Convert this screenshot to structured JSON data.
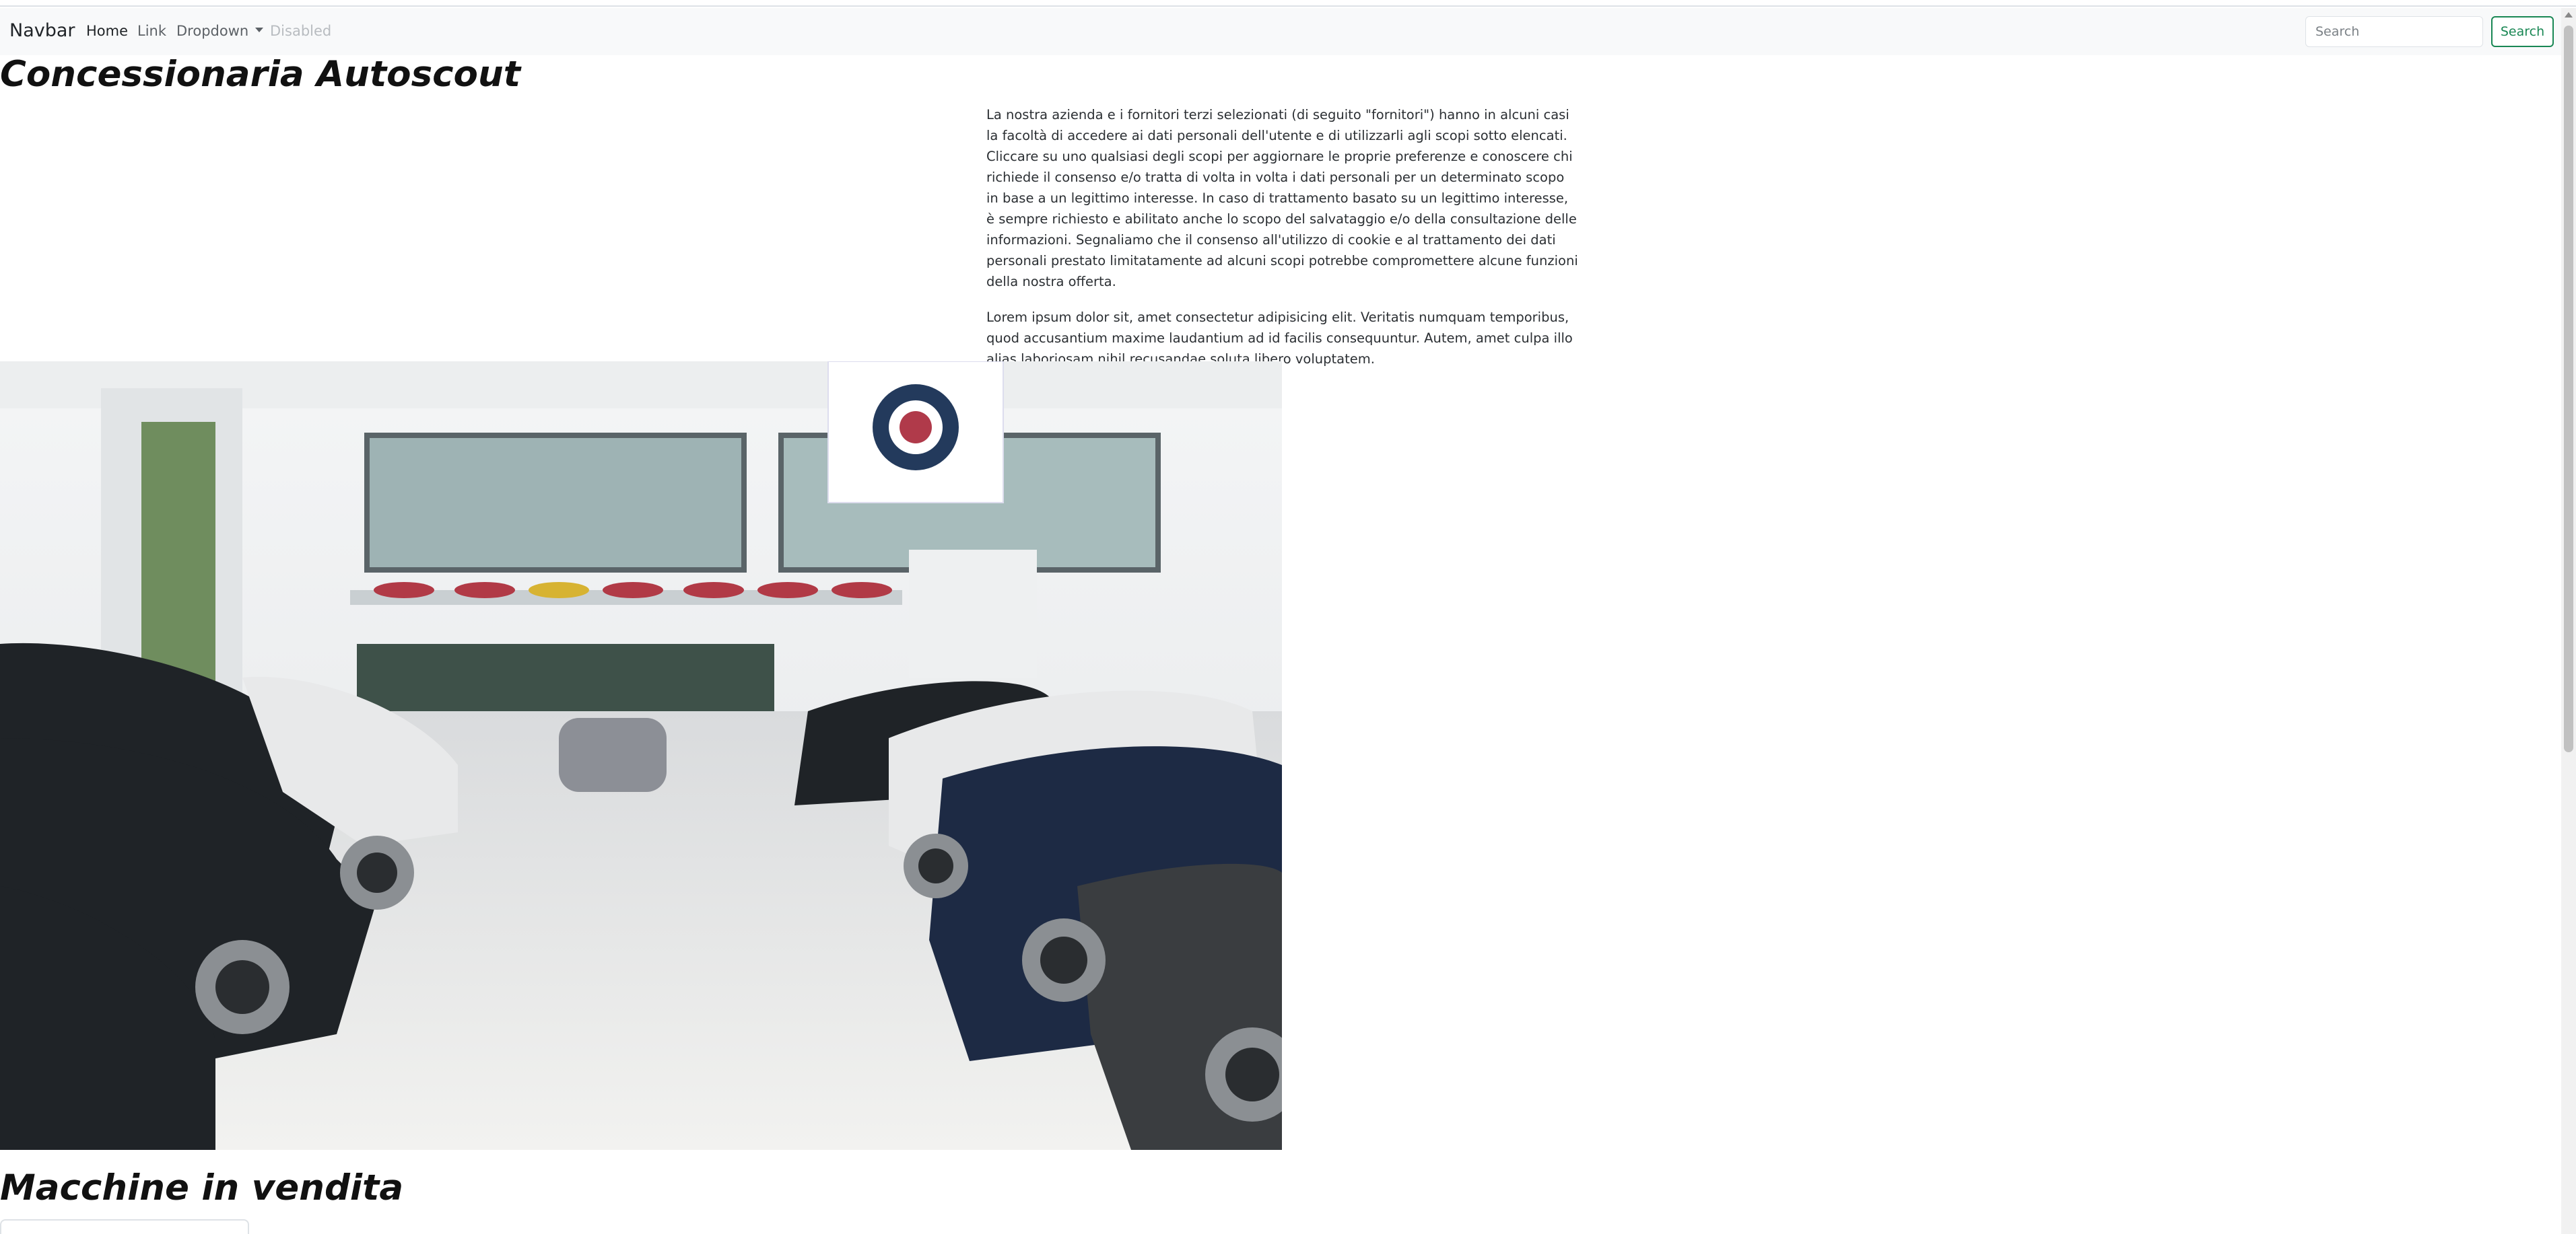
{
  "navbar": {
    "brand": "Navbar",
    "items": [
      {
        "label": "Home"
      },
      {
        "label": "Link"
      },
      {
        "label": "Dropdown"
      },
      {
        "label": "Disabled"
      }
    ],
    "search": {
      "placeholder": "Search",
      "value": "",
      "button_label": "Search"
    }
  },
  "page": {
    "title": "Concessionaria Autoscout",
    "intro_paragraphs": [
      "La nostra azienda e i fornitori terzi selezionati (di seguito \"fornitori\") hanno in alcuni casi la facoltà di accedere ai dati personali dell'utente e di utilizzarli agli scopi sotto elencati. Cliccare su uno qualsiasi degli scopi per aggiornare le proprie preferenze e conoscere chi richiede il consenso e/o tratta di volta in volta i dati personali per un determinato scopo in base a un legittimo interesse. In caso di trattamento basato su un legittimo interesse, è sempre richiesto e abilitato anche lo scopo del salvataggio e/o della consultazione delle informazioni. Segnaliamo che il consenso all'utilizzo di cookie e al trattamento dei dati personali prestato limitatamente ad alcuni scopi potrebbe compromettere alcune funzioni della nostra offerta.",
      "Lorem ipsum dolor sit, amet consectetur adipisicing elit. Veritatis numquam temporibus, quod accusantium maxime laudantium ad id facilis consequuntur. Autem, amet culpa illo alias laboriosam nihil recusandae soluta libero voluptatem."
    ],
    "section_title": "Macchine in vendita"
  },
  "colors": {
    "navbar_bg": "#f8f9fa",
    "success": "#198754",
    "text": "#212529"
  }
}
